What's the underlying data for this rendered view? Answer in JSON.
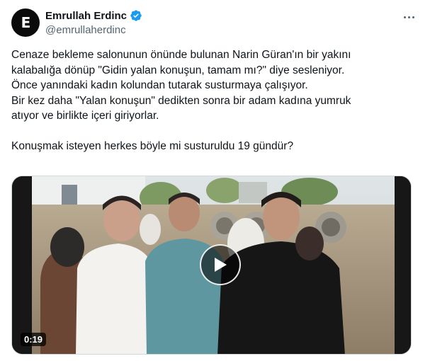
{
  "author": {
    "display_name": "Emrullah Erdinc",
    "handle": "@emrullaherdinc",
    "avatar_glyph": "E",
    "verified_icon": "verified-badge-icon",
    "verified_color": "#1d9bf0"
  },
  "more_icon": "more-options-icon",
  "tweet_lines": [
    "Cenaze bekleme salonunun önünde bulunan Narin Güran'ın bir yakını",
    "kalabalığa dönüp \"Gidin yalan konuşun, tamam mı?\" diye sesleniyor.",
    "Önce yanındaki kadın kolundan tutarak susturmaya çalışıyor.",
    "Bir kez daha \"Yalan konuşun\" dedikten sonra bir adam kadına yumruk",
    "atıyor ve birlikte içeri giriyorlar."
  ],
  "tweet_question": "Konuşmak isteyen herkes böyle mi susturuldu 19 gündür?",
  "video": {
    "duration": "0:19",
    "play_icon": "play-icon"
  }
}
